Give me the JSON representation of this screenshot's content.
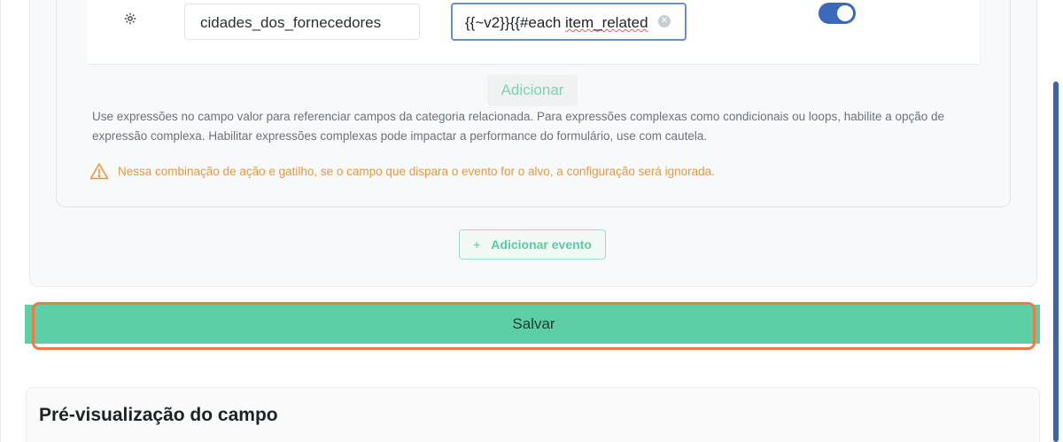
{
  "mapping_row": {
    "icon": "gear-icon",
    "field_value": "cidades_dos_fornecedores",
    "expression_prefix": "{{~v2}}{{#each ",
    "expression_squiggle": "item_related",
    "toggle_state": "on"
  },
  "add_button_label": "Adicionar",
  "help_text": "Use expressões no campo valor para referenciar campos da categoria relacionada. Para expressões complexas como condicionais ou loops, habilite a opção de expressão complexa. Habilitar expressões complexas pode impactar a performance do formulário, use com cautela.",
  "warning": {
    "icon": "warning-icon",
    "text": "Nessa combinação de ação e gatilho, se o campo que dispara o evento for o alvo, a configuração será ignorada."
  },
  "add_event_button": {
    "icon": "plus-icon",
    "label": "Adicionar evento"
  },
  "save_button_label": "Salvar",
  "preview": {
    "title": "Pré-visualização do campo"
  },
  "colors": {
    "accent_green": "#5ccfa6",
    "toggle_blue": "#3b68b8",
    "warning_orange": "#e39a3b",
    "highlight_orange": "#f07a45"
  }
}
